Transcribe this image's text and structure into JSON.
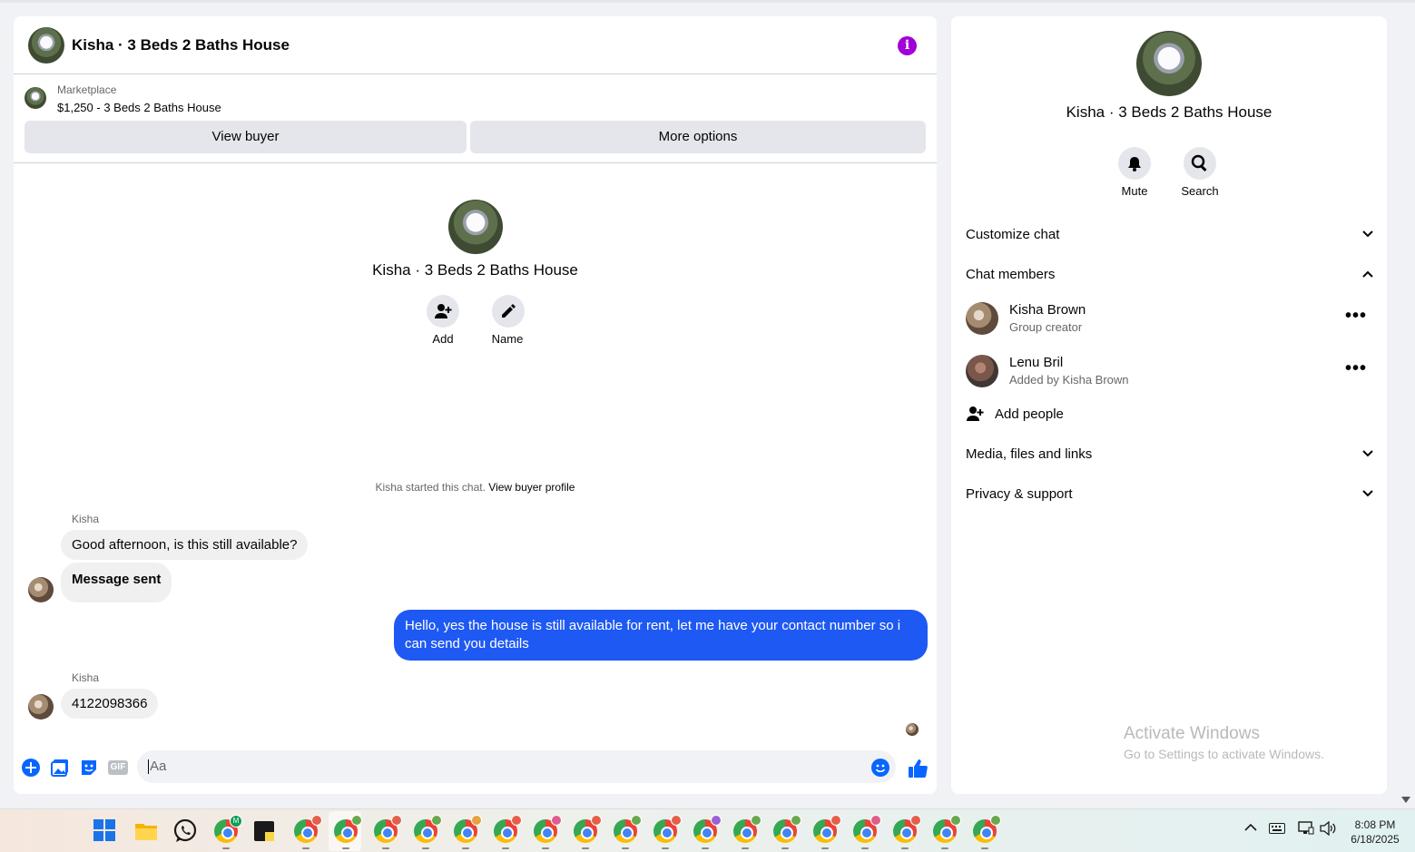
{
  "chat": {
    "title": "Kisha · 3 Beds 2 Baths House",
    "marketplace_label": "Marketplace",
    "listing_title": "$1,250 - 3 Beds 2 Baths House",
    "view_buyer_label": "View buyer",
    "more_options_label": "More options",
    "hero_title": "Kisha · 3 Beds 2 Baths House",
    "add_label": "Add",
    "name_label": "Name",
    "system_text": "Kisha started this chat.",
    "system_link": "View buyer profile",
    "messages": [
      {
        "sender": "Kisha",
        "text": "Good afternoon, is this still available?"
      },
      {
        "text": "Message sent"
      },
      {
        "text": "Hello, yes the house is still available for rent, let me have your contact number so i can send you  details"
      },
      {
        "sender": "Kisha",
        "text": "4122098366"
      }
    ],
    "composer_placeholder": "Aa",
    "gif_label": "GIF"
  },
  "side": {
    "title": "Kisha · 3 Beds 2 Baths House",
    "mute_label": "Mute",
    "search_label": "Search",
    "customize_label": "Customize chat",
    "members_label": "Chat members",
    "members": [
      {
        "name": "Kisha Brown",
        "sub": "Group creator"
      },
      {
        "name": "Lenu Bril",
        "sub": "Added by Kisha Brown"
      }
    ],
    "add_people_label": "Add people",
    "media_label": "Media, files and links",
    "privacy_label": "Privacy & support",
    "watermark_title": "Activate Windows",
    "watermark_sub": "Go to Settings to activate Windows."
  },
  "taskbar": {
    "time": "8:08 PM",
    "date": "6/18/2025",
    "chrome_profile_colors": [
      "#e45f4a",
      "#6aa84f",
      "#e45f4a",
      "#6aa84f",
      "#e6a23c",
      "#e45f4a",
      "#e05c8c",
      "#e45f4a",
      "#6aa84f",
      "#e45f4a",
      "#9c5fd6",
      "#6aa84f",
      "#6aa84f",
      "#e45f4a",
      "#e05c8c",
      "#e45f4a",
      "#6aa84f",
      "#6aa84f"
    ]
  },
  "colors": {
    "accent": "#1e59f3",
    "info": "#a100d6"
  }
}
